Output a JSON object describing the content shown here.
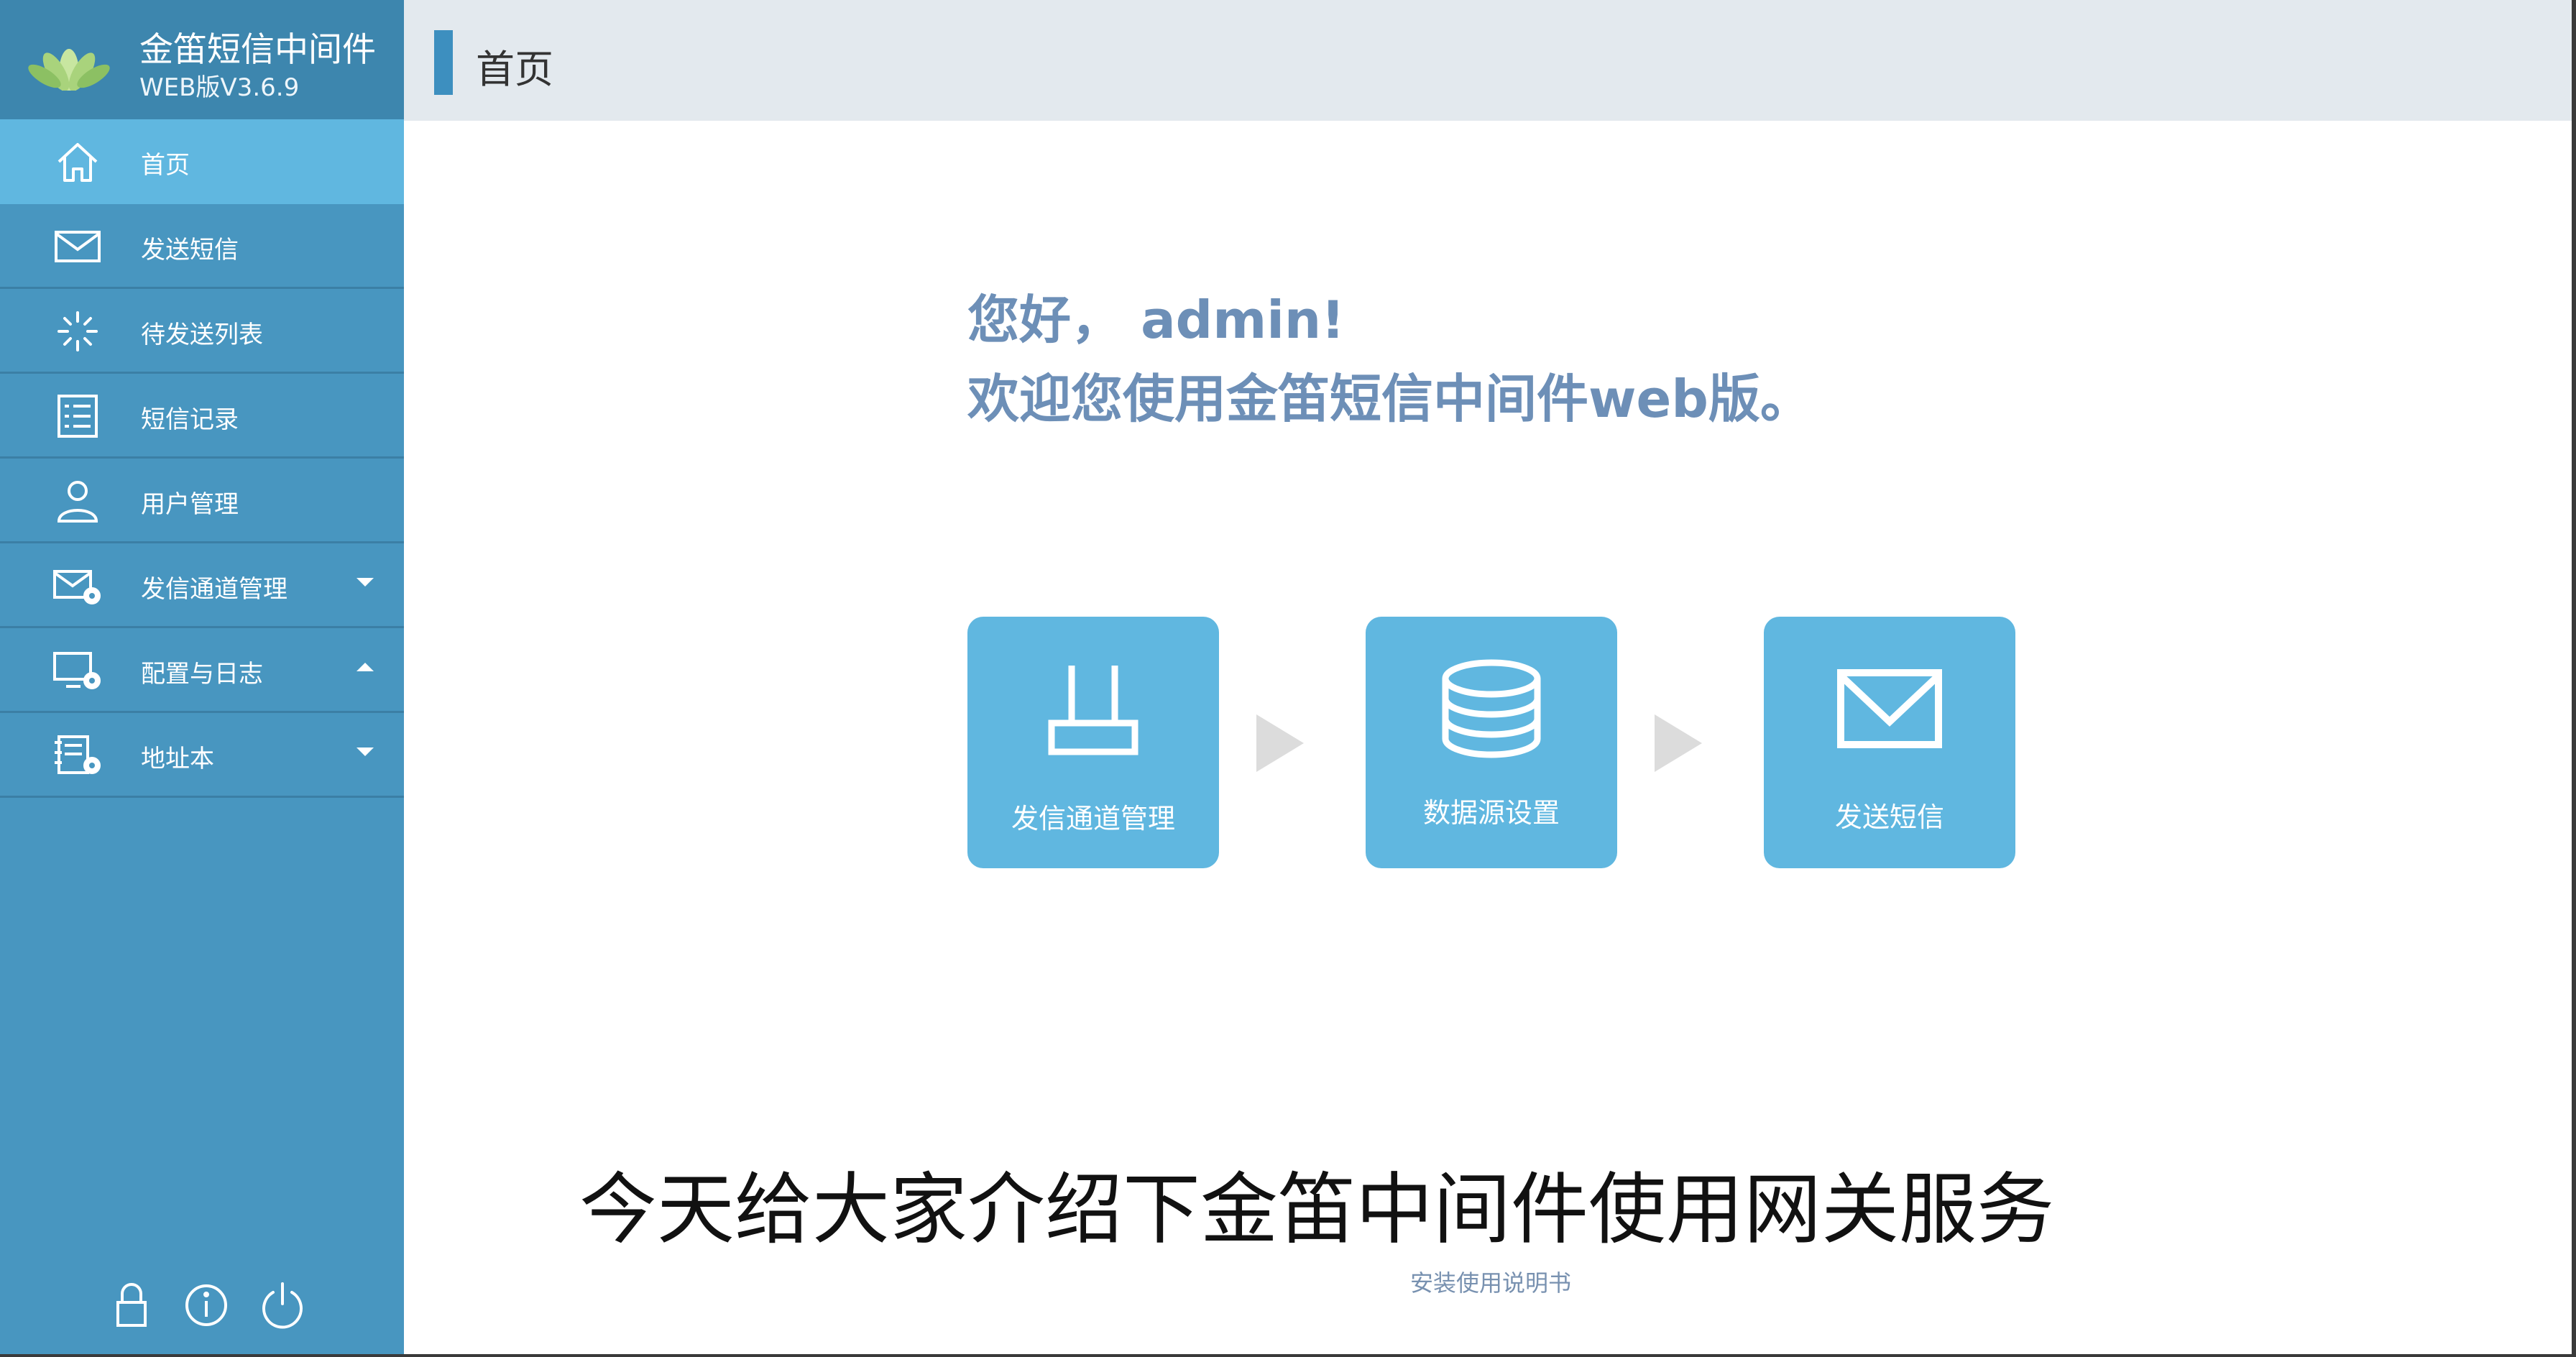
{
  "app": {
    "title": "金笛短信中间件",
    "version": "WEB版V3.6.9"
  },
  "sidebar": {
    "items": [
      {
        "label": "首页",
        "icon": "home-icon",
        "active": true
      },
      {
        "label": "发送短信",
        "icon": "mail-icon"
      },
      {
        "label": "待发送列表",
        "icon": "loading-icon"
      },
      {
        "label": "短信记录",
        "icon": "list-icon"
      },
      {
        "label": "用户管理",
        "icon": "user-icon"
      },
      {
        "label": "发信通道管理",
        "icon": "mail-settings-icon",
        "caret": "down"
      },
      {
        "label": "配置与日志",
        "icon": "monitor-settings-icon",
        "caret": "up"
      },
      {
        "label": "地址本",
        "icon": "addressbook-settings-icon",
        "caret": "down"
      }
    ],
    "footer_icons": [
      "lock-icon",
      "info-icon",
      "power-icon"
    ]
  },
  "header": {
    "page_title": "首页"
  },
  "main": {
    "greeting_line1": "您好， admin!",
    "greeting_line2": "欢迎您使用金笛短信中间件web版。",
    "tiles": [
      {
        "label": "发信通道管理",
        "icon": "router-icon"
      },
      {
        "label": "数据源设置",
        "icon": "database-icon"
      },
      {
        "label": "发送短信",
        "icon": "envelope-icon"
      }
    ],
    "subtitle": "今天给大家介绍下金笛中间件使用网关服务",
    "manual_link": "安装使用说明书"
  },
  "colors": {
    "sidebar_bg": "#4896c0",
    "sidebar_active": "#60b7e0",
    "tile_bg": "#60b7e0",
    "greeting_text": "#6d8fb7",
    "header_bg": "#e3e9ee",
    "header_accent": "#3d8fbf"
  }
}
